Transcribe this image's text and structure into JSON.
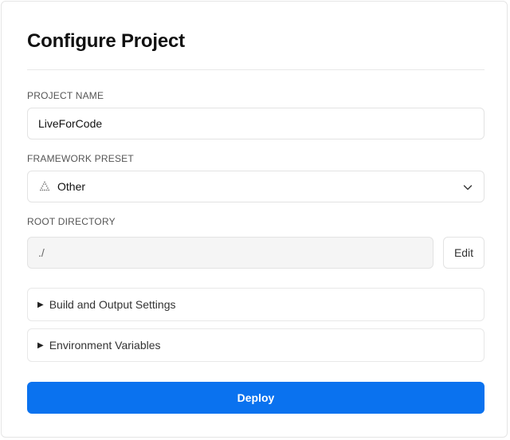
{
  "page": {
    "title": "Configure Project"
  },
  "project_name": {
    "label": "PROJECT NAME",
    "value": "LiveForCode"
  },
  "framework_preset": {
    "label": "FRAMEWORK PRESET",
    "selected": "Other",
    "icon": "triangle-dots-icon"
  },
  "root_directory": {
    "label": "ROOT DIRECTORY",
    "value": "./",
    "edit_label": "Edit"
  },
  "sections": {
    "build_output": "Build and Output Settings",
    "env_vars": "Environment Variables"
  },
  "actions": {
    "deploy_label": "Deploy"
  },
  "colors": {
    "accent": "#0a72ef"
  }
}
